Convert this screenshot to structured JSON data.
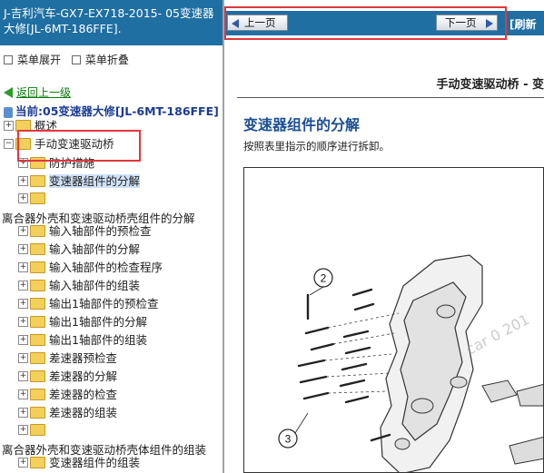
{
  "left_panel": {
    "header_title": "J-吉利汽车-GX7-EX718-2015- 05变速器大修[JL-6MT-186FFE].",
    "menu_expand": "菜单展开",
    "menu_collapse": "菜单折叠",
    "back_link": "返回上一级",
    "current_path": "当前:05变速器大修[JL-6MT-186FFE]",
    "tree": {
      "overview": "概述",
      "manual_transaxle": "手动变速驱动桥",
      "protective": "防护措施",
      "disassembly": "变速器组件的分解"
    },
    "category_1": "离合器外壳和变速驱动桥壳组件的分解",
    "category_1_items": [
      "输入轴部件的预检查",
      "输入轴部件的分解",
      "输入轴部件的检查程序",
      "输入轴部件的组装",
      "输出1轴部件的预检查",
      "输出1轴部件的分解",
      "输出1轴部件的组装",
      "差速器预检查",
      "差速器的分解",
      "差速器的检查",
      "差速器的组装"
    ],
    "category_2": "离合器外壳和变速驱动桥壳体组件的组装",
    "category_2_items": [
      "变速器组件的组装"
    ]
  },
  "right_panel": {
    "prev_button": "上一页",
    "next_button": "下一页",
    "refresh": "[刷新",
    "doc_title": "手动变速驱动桥 - 变",
    "section_title": "变速器组件的分解",
    "instruction": "按照表里指示的顺序进行拆卸。",
    "callouts": [
      "2",
      "3"
    ],
    "watermark": "car 0 201"
  },
  "colors": {
    "header_blue": "#1f6fa3",
    "highlight_red": "#e0383e",
    "section_blue": "#1b4f92",
    "link_green": "#0a7a0a",
    "current_blue": "#1a3c96"
  }
}
